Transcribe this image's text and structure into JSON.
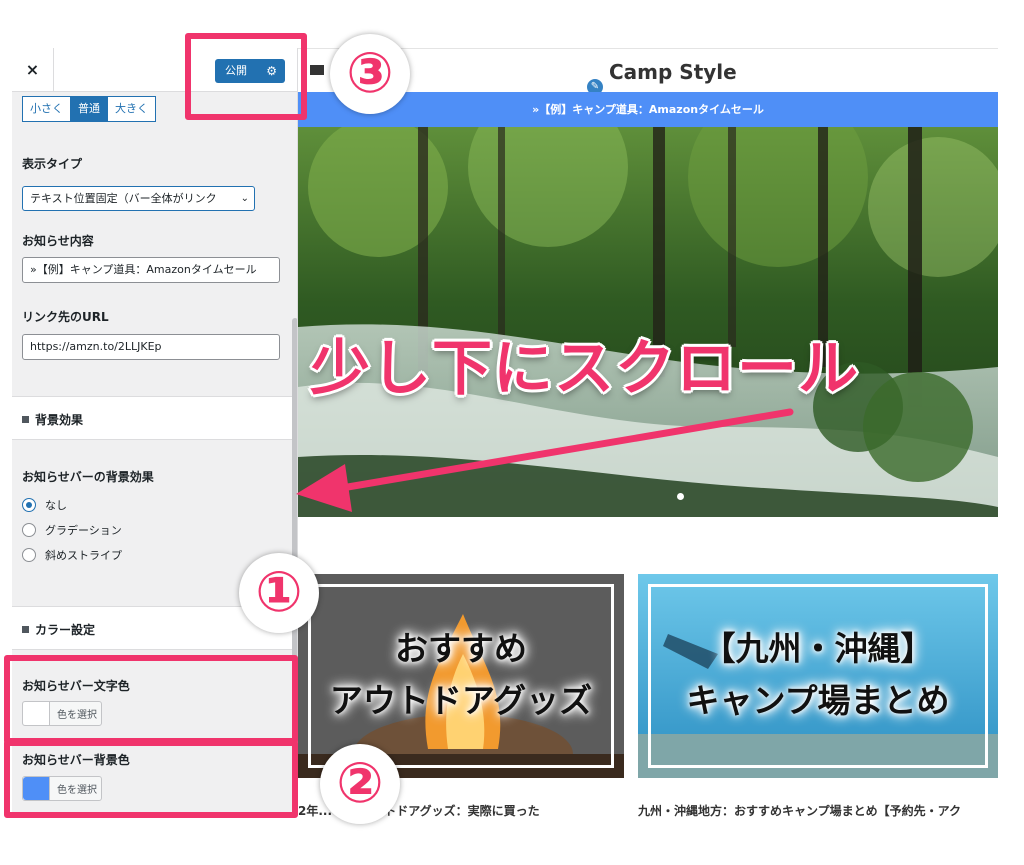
{
  "sidebar": {
    "close_symbol": "×",
    "publish_label": "公開",
    "size_buttons": [
      "小さく",
      "普通",
      "大きく"
    ],
    "display_type": {
      "label": "表示タイプ",
      "value": "テキスト位置固定（バー全体がリンク"
    },
    "notice_content": {
      "label": "お知らせ内容",
      "value": "»【例】キャンプ道具：Amazonタイムセール"
    },
    "link_url": {
      "label": "リンク先のURL",
      "value": "https://amzn.to/2LLJKEp"
    },
    "bg_effect_section": "背景効果",
    "bg_effect": {
      "label": "お知らせバーの背景効果",
      "options": [
        "なし",
        "グラデーション",
        "斜めストライプ"
      ],
      "selected": "なし"
    },
    "color_section": "カラー設定",
    "text_color": {
      "label": "お知らせバー文字色",
      "button": "色を選択",
      "swatch": "#ffffff"
    },
    "bg_color": {
      "label": "お知らせバー背景色",
      "button": "色を選択",
      "swatch": "#4f8ff7"
    }
  },
  "preview": {
    "site_title": "Camp Style",
    "notice_bar_text": "»【例】キャンプ道具：Amazonタイムセール",
    "cards": [
      {
        "line1": "おすすめ",
        "line2": "アウトドアグッズ",
        "caption": "2年... すめアウトドアグッズ：実際に買った"
      },
      {
        "line1": "【九州・沖縄】",
        "line2": "キャンプ場まとめ",
        "caption": "九州・沖縄地方：おすすめキャンプ場まとめ【予約先・アク"
      }
    ]
  },
  "annotations": {
    "scroll_text": "少し下にスクロール",
    "numbers": [
      "①",
      "②",
      "③"
    ]
  },
  "colors": {
    "accent": "#f0346c",
    "wp_blue": "#2271b1",
    "notice_bar": "#4f8ff7"
  }
}
